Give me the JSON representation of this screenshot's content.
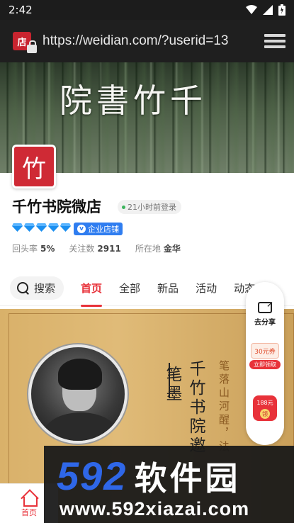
{
  "status": {
    "time": "2:42"
  },
  "browser": {
    "site_icon_text": "店",
    "url": "https://weidian.com/?userid=13"
  },
  "banner": {
    "title": "院書竹千"
  },
  "shop": {
    "logo_text": "竹",
    "name": "千竹书院微店",
    "login": "21小时前登录",
    "badge": "企业店铺",
    "badge_icon": "v",
    "diamond_count": 5,
    "stats": [
      {
        "label": "回头率",
        "value": "5%"
      },
      {
        "label": "关注数",
        "value": "2911"
      },
      {
        "label": "所在地",
        "value": "金华"
      }
    ]
  },
  "tabs": {
    "search": "搜索",
    "items": [
      "首页",
      "全部",
      "新品",
      "活动",
      "动态"
    ],
    "active": "首页"
  },
  "poster": {
    "line_main": "千竹书院邀",
    "line_sub": "笔墨",
    "line_small": "笔落山河醒，法"
  },
  "side": {
    "share": "去分享",
    "coupon": "30元券",
    "coupon_btn": "立即领取",
    "redpack": "188元",
    "redpack_sub": "领"
  },
  "bottom": {
    "home": "首页"
  },
  "watermark": {
    "top_num": "592",
    "top_cn": "软件园",
    "url": "www.592xiazai.com"
  },
  "colors": {
    "accent": "#e8323a",
    "brand_red": "#cf2a35",
    "enterprise_blue": "#2f7df0",
    "watermark_blue": "#2f67e8"
  },
  "icons": [
    "wifi-icon",
    "signal-icon",
    "battery-icon",
    "lock-icon",
    "menu-icon",
    "search-icon",
    "share-icon",
    "home-icon",
    "diamond-icon"
  ]
}
